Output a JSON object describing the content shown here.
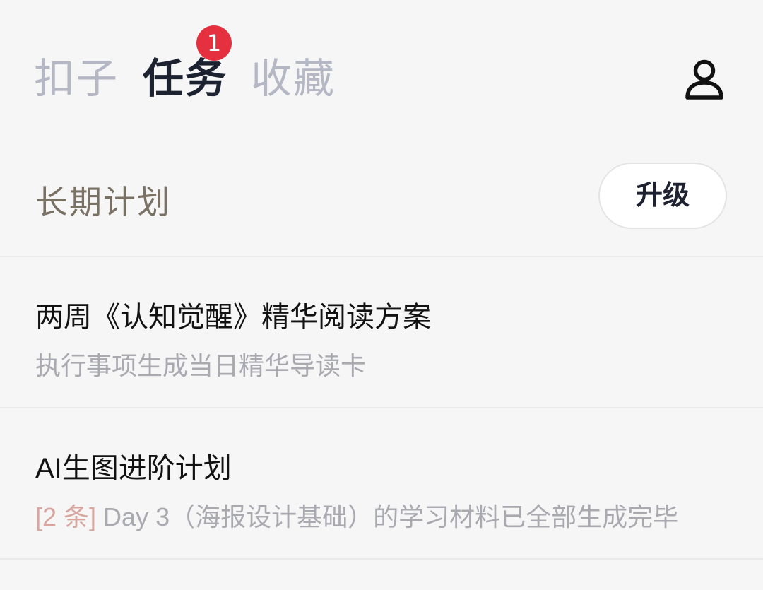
{
  "nav": {
    "tabs": [
      {
        "label": "扣子",
        "active": false
      },
      {
        "label": "任务",
        "active": true,
        "badge": "1"
      },
      {
        "label": "收藏",
        "active": false
      }
    ],
    "profile_icon": "user-profile-icon"
  },
  "section": {
    "title": "长期计划",
    "upgrade_label": "升级"
  },
  "items": [
    {
      "title": "两周《认知觉醒》精华阅读方案",
      "subtitle": "执行事项生成当日精华导读卡"
    },
    {
      "title": "AI生图进阶计划",
      "tag": "[2 条]",
      "subtitle": "Day 3（海报设计基础）的学习材料已全部生成完毕"
    }
  ],
  "colors": {
    "background": "#f6f6f6",
    "badge": "#e5303f",
    "tab_inactive": "#b5b8c4",
    "tab_active": "#1c2230",
    "tag": "#d7a6a0"
  }
}
